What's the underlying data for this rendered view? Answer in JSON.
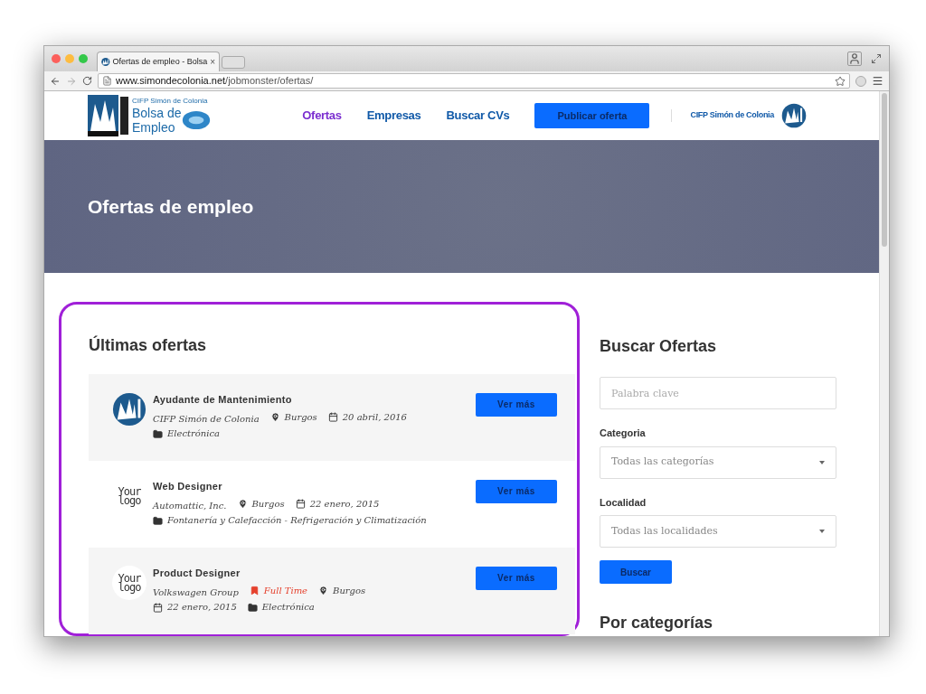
{
  "browser": {
    "tab": {
      "title": "Ofertas de empleo - Bolsa",
      "close": "×"
    },
    "url": {
      "host": "www.simondecolonia.net",
      "path": "/jobmonster/ofertas/"
    }
  },
  "header": {
    "logo": {
      "line1": "CIFP Simón de Colonia",
      "line2": "Bolsa de",
      "line3": "Empleo"
    },
    "nav": [
      {
        "label": "Ofertas",
        "selected": true
      },
      {
        "label": "Empresas",
        "selected": false
      },
      {
        "label": "Buscar CVs",
        "selected": false
      }
    ],
    "cta": "Publicar oferta",
    "school": "CIFP Simón de Colonia"
  },
  "banner": {
    "title": "Ofertas de empleo"
  },
  "latest": {
    "title": "Últimas ofertas",
    "jobs": [
      {
        "title": "Ayudante de Mantenimiento",
        "logo": {
          "kind": "school"
        },
        "button": "Ver más",
        "meta": [
          {
            "kind": "company",
            "text": "CIFP Simón de Colonia"
          },
          {
            "kind": "location",
            "text": "Burgos"
          },
          {
            "kind": "date",
            "text": "20 abril, 2016"
          },
          {
            "kind": "category",
            "text": "Electrónica"
          }
        ]
      },
      {
        "title": "Web Designer",
        "logo": {
          "kind": "placeholder",
          "text": [
            "Your",
            "logo"
          ]
        },
        "button": "Ver más",
        "meta": [
          {
            "kind": "company",
            "text": "Automattic, Inc."
          },
          {
            "kind": "location",
            "text": "Burgos"
          },
          {
            "kind": "date",
            "text": "22 enero, 2015"
          },
          {
            "kind": "category",
            "text": "Fontanería y Calefacción - Refrigeración y Climatización"
          }
        ]
      },
      {
        "title": "Product Designer",
        "logo": {
          "kind": "placeholder",
          "text": [
            "Your",
            "logo"
          ]
        },
        "button": "Ver más",
        "meta": [
          {
            "kind": "company",
            "text": "Volkswagen Group"
          },
          {
            "kind": "type",
            "text": "Full Time",
            "color": "#e5412d"
          },
          {
            "kind": "location",
            "text": "Burgos"
          },
          {
            "kind": "date",
            "text": "22 enero, 2015"
          },
          {
            "kind": "category",
            "text": "Electrónica"
          }
        ]
      }
    ]
  },
  "search": {
    "title": "Buscar Ofertas",
    "keyword": {
      "placeholder": "Palabra clave"
    },
    "selects": [
      {
        "label": "Categoria",
        "value": "Todas las categorías"
      },
      {
        "label": "Localidad",
        "value": "Todas las localidades"
      }
    ],
    "button": "Buscar"
  },
  "categories": {
    "title": "Por categorías"
  }
}
